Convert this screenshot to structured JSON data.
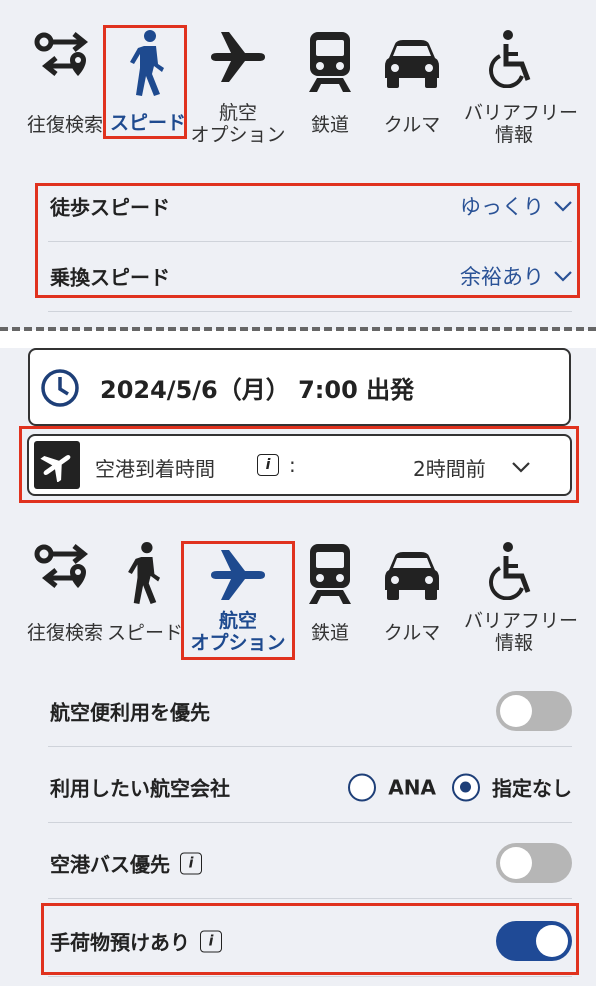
{
  "top_tabs": [
    {
      "icon": "route-swap-icon",
      "label1": "往復検索",
      "label2": ""
    },
    {
      "icon": "walking-icon",
      "label1": "スピード",
      "label2": "",
      "active": true
    },
    {
      "icon": "airplane-icon",
      "label1": "航空",
      "label2": "オプション"
    },
    {
      "icon": "train-icon",
      "label1": "鉄道",
      "label2": ""
    },
    {
      "icon": "car-icon",
      "label1": "クルマ",
      "label2": ""
    },
    {
      "icon": "wheelchair-icon",
      "label1": "バリアフリー",
      "label2": "情報"
    }
  ],
  "speed": {
    "walking_label": "徒歩スピード",
    "walking_value": "ゆっくり",
    "transfer_label": "乗換スピード",
    "transfer_value": "余裕あり"
  },
  "datetime": {
    "text": "2024/5/6（月） 7:00 出発"
  },
  "airport": {
    "label": "空港到着時間",
    "colon": ":",
    "value": "2時間前"
  },
  "bottom_tabs": [
    {
      "icon": "route-swap-icon",
      "label1": "往復検索",
      "label2": ""
    },
    {
      "icon": "walking-icon",
      "label1": "スピード",
      "label2": ""
    },
    {
      "icon": "airplane-icon",
      "label1": "航空",
      "label2": "オプション",
      "active": true
    },
    {
      "icon": "train-icon",
      "label1": "鉄道",
      "label2": ""
    },
    {
      "icon": "car-icon",
      "label1": "クルマ",
      "label2": ""
    },
    {
      "icon": "wheelchair-icon",
      "label1": "バリアフリー",
      "label2": "情報"
    }
  ],
  "options": {
    "prefer_air": "航空便利用を優先",
    "airline_label": "利用したい航空会社",
    "airline_ana": "ANA",
    "airline_none": "指定なし",
    "airport_bus": "空港バス優先",
    "baggage": "手荷物預けあり",
    "info_glyph": "i"
  },
  "colors": {
    "accent": "#1f4a96",
    "highlight": "#e0321e"
  }
}
